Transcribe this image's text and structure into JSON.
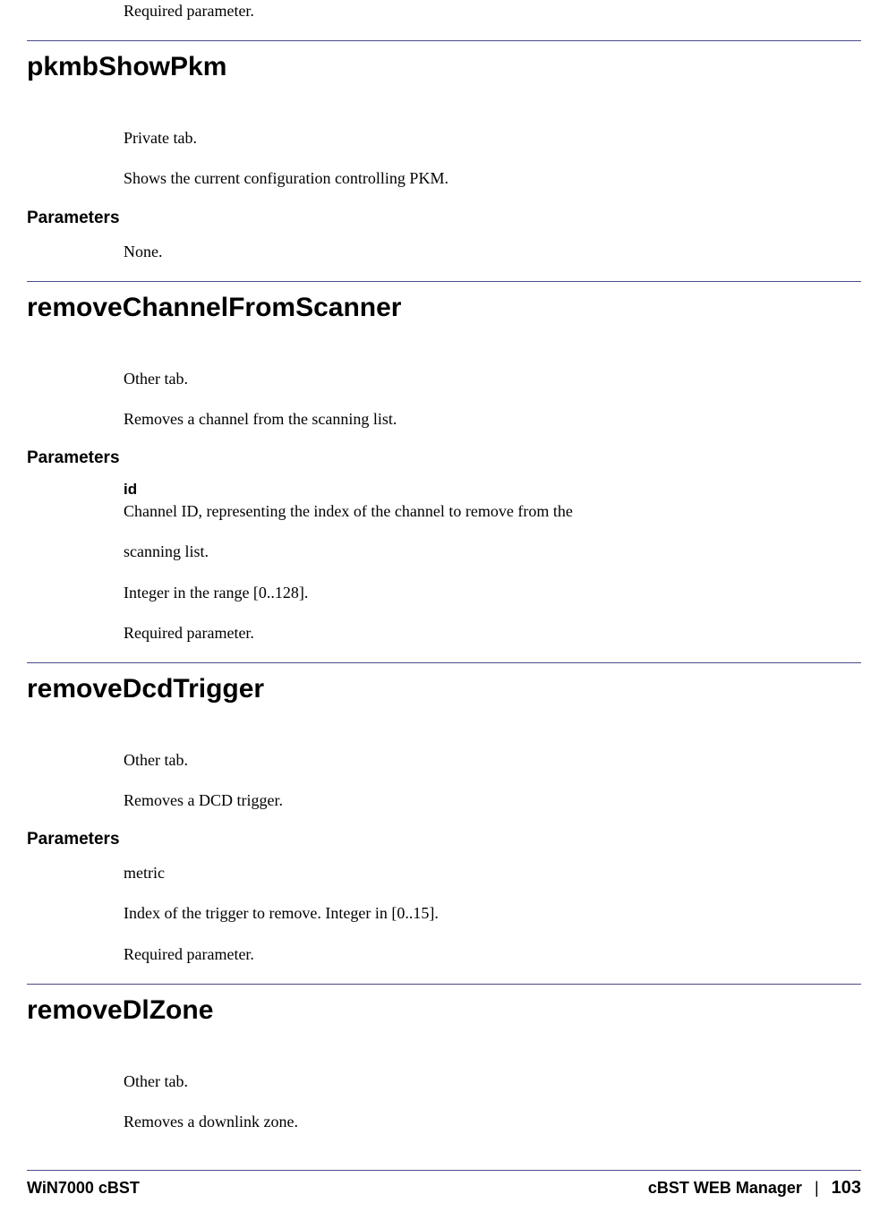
{
  "intro": {
    "required": "Required parameter."
  },
  "sections": {
    "pkmbShowPkm": {
      "heading": "pkmbShowPkm",
      "tab": "Private tab.",
      "desc": "Shows the current configuration controlling PKM.",
      "params_label": "Parameters",
      "params_none": "None."
    },
    "removeChannelFromScanner": {
      "heading": "removeChannelFromScanner",
      "tab": "Other tab.",
      "desc": "Removes a channel from the scanning list.",
      "params_label": "Parameters",
      "param_id_name": "id",
      "param_id_desc1": "Channel ID, representing the index of the channel to remove from the",
      "param_id_desc2": "scanning list.",
      "param_id_range": "Integer in the range [0..128].",
      "param_id_required": "Required parameter."
    },
    "removeDcdTrigger": {
      "heading": "removeDcdTrigger",
      "tab": "Other tab.",
      "desc": "Removes a DCD trigger.",
      "params_label": "Parameters",
      "param_metric": "metric",
      "param_metric_desc": "Index of the trigger to remove. Integer in [0..15].",
      "param_metric_required": "Required parameter."
    },
    "removeDlZone": {
      "heading": "removeDlZone",
      "tab": "Other tab.",
      "desc": "Removes a downlink zone."
    }
  },
  "footer": {
    "left": "WiN7000 cBST",
    "right_title": "cBST WEB Manager",
    "sep": "|",
    "page": "103"
  }
}
